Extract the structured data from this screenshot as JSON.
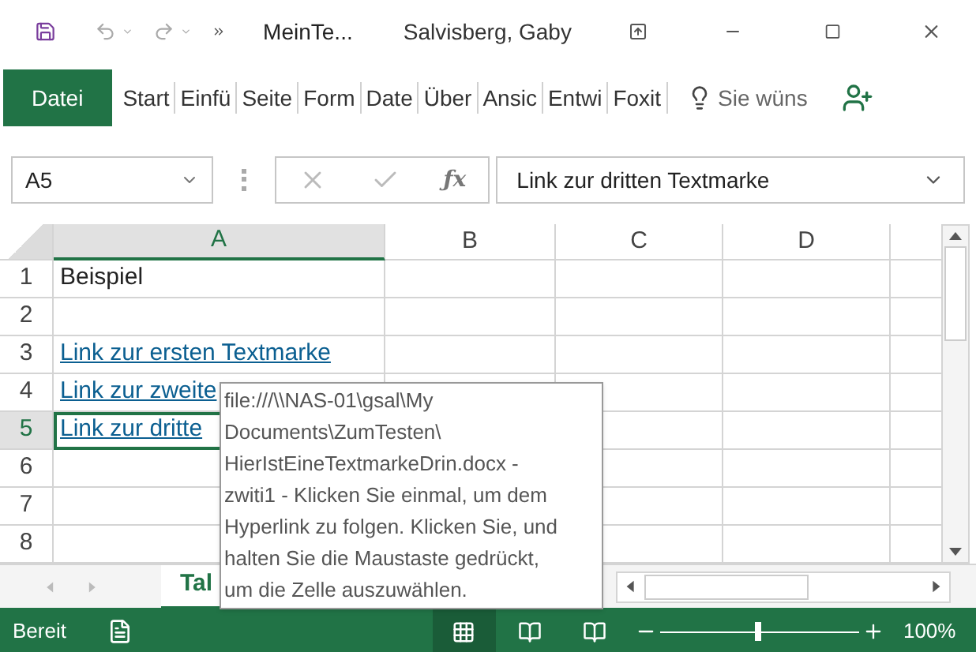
{
  "title_bar": {
    "document": "MeinTe...",
    "user": "Salvisberg, Gaby"
  },
  "ribbon_tabs": [
    {
      "label": "Datei",
      "selected": true
    },
    {
      "label": "Start",
      "selected": false
    },
    {
      "label": "Einfü",
      "selected": false
    },
    {
      "label": "Seite",
      "selected": false
    },
    {
      "label": "Form",
      "selected": false
    },
    {
      "label": "Date",
      "selected": false
    },
    {
      "label": "Über",
      "selected": false
    },
    {
      "label": "Ansic",
      "selected": false
    },
    {
      "label": "Entwi",
      "selected": false
    },
    {
      "label": "Foxit",
      "selected": false
    }
  ],
  "tell_me": {
    "placeholder": "Sie wüns"
  },
  "name_box": {
    "value": "A5"
  },
  "formula_bar": {
    "function_label": "ƒx",
    "value": "Link zur dritten Textmarke"
  },
  "columns": [
    {
      "label": "A",
      "selected": true
    },
    {
      "label": "B",
      "selected": false
    },
    {
      "label": "C",
      "selected": false
    },
    {
      "label": "D",
      "selected": false
    }
  ],
  "rows": [
    {
      "number": "1",
      "selected": false,
      "cell_a": {
        "text": "Beispiel",
        "kind": "text"
      }
    },
    {
      "number": "2",
      "selected": false
    },
    {
      "number": "3",
      "selected": false,
      "cell_a": {
        "text": "Link zur ersten Textmarke",
        "kind": "link"
      }
    },
    {
      "number": "4",
      "selected": false,
      "cell_a": {
        "text": "Link zur zweite",
        "kind": "link"
      }
    },
    {
      "number": "5",
      "selected": true,
      "cell_a": {
        "text": "Link zur dritte",
        "kind": "link"
      }
    },
    {
      "number": "6",
      "selected": false
    },
    {
      "number": "7",
      "selected": false
    },
    {
      "number": "8",
      "selected": false
    }
  ],
  "sheet_tabs": [
    {
      "label": "Tal",
      "selected": true
    }
  ],
  "tooltip": {
    "text": "file:///\\\\NAS-01\\gsal\\My\nDocuments\\ZumTesten\\\nHierIstEineTextmarkeDrin.docx -\nzwiti1 - Klicken Sie einmal, um dem\nHyperlink zu folgen. Klicken Sie, und\nhalten Sie die Maustaste gedrückt,\num die Zelle auszuwählen."
  },
  "status_bar": {
    "status": "Bereit",
    "zoom": {
      "level": 0.49,
      "reading": "100%"
    }
  }
}
